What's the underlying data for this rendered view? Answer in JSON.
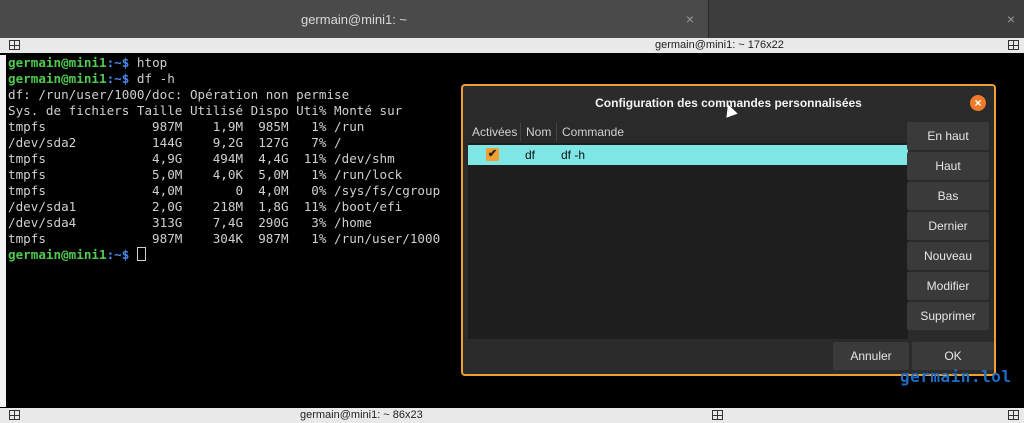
{
  "tabs": [
    {
      "label": "germain@mini1: ~",
      "close": "×"
    },
    {
      "label": "",
      "close": "×"
    }
  ],
  "terminal_top": {
    "title": "germain@mini1: ~ 176x22"
  },
  "terminal_bottom": {
    "title": "germain@mini1: ~ 86x23"
  },
  "terminal": {
    "prompt_user": "germain@mini1",
    "prompt_path": ":~$",
    "commands": [
      "htop",
      "df -h"
    ],
    "error": "df: /run/user/1000/doc: Opération non permise",
    "header": "Sys. de fichiers Taille Utilisé Dispo Uti% Monté sur",
    "rows": [
      "tmpfs              987M    1,9M  985M   1% /run",
      "/dev/sda2          144G    9,2G  127G   7% /",
      "tmpfs              4,9G    494M  4,4G  11% /dev/shm",
      "tmpfs              5,0M    4,0K  5,0M   1% /run/lock",
      "tmpfs              4,0M       0  4,0M   0% /sys/fs/cgroup",
      "/dev/sda1          2,0G    218M  1,8G  11% /boot/efi",
      "/dev/sda4          313G    7,4G  290G   3% /home",
      "tmpfs              987M    304K  987M   1% /run/user/1000"
    ]
  },
  "dialog": {
    "title": "Configuration des commandes personnalisées",
    "close": "×",
    "columns": [
      "Activées",
      "Nom",
      "Commande"
    ],
    "rows": [
      {
        "enabled": true,
        "check": "✔",
        "name": "df",
        "command": "df -h"
      }
    ],
    "side_buttons": [
      "En haut",
      "Haut",
      "Bas",
      "Dernier",
      "Nouveau",
      "Modifier",
      "Supprimer"
    ],
    "cancel": "Annuler",
    "ok": "OK"
  },
  "watermark": "germain.lol",
  "colors": {
    "accent": "#f0a030",
    "selection": "#7fe6e6",
    "prompt_user": "#4ec94e",
    "prompt_path": "#4a8cf0"
  },
  "icons": [
    "split-terminal-icon",
    "close-icon",
    "check-icon",
    "mouse-pointer-icon"
  ]
}
